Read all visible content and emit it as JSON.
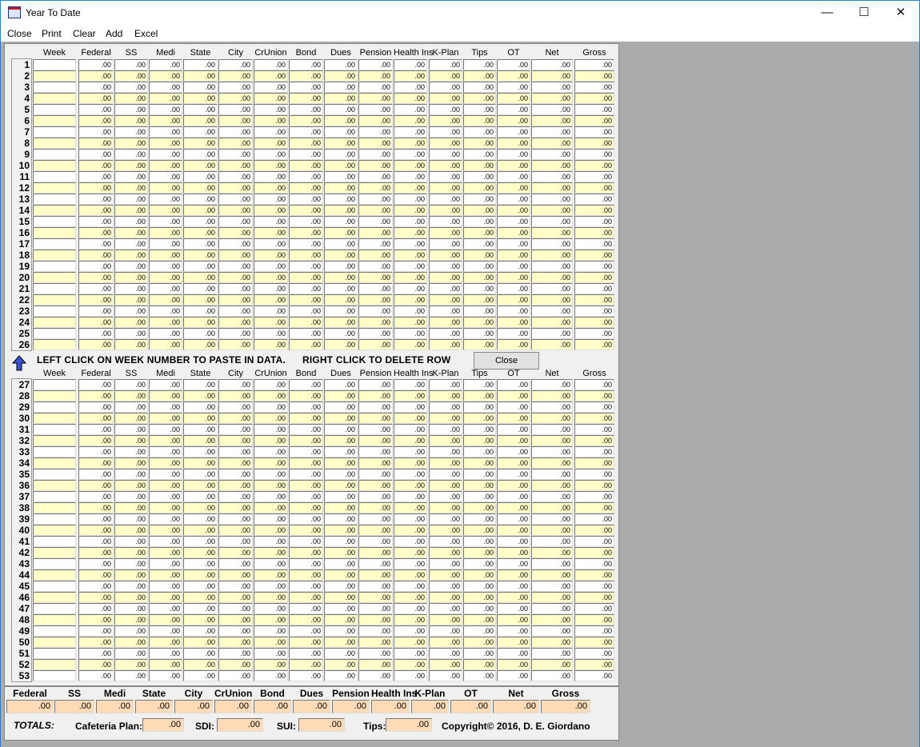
{
  "window": {
    "title": "Year To Date",
    "minimize": "—",
    "maximize": "☐",
    "close": "✕"
  },
  "menu": [
    "Close",
    "Print",
    "Clear",
    "Add",
    "Excel"
  ],
  "columns": [
    "Week",
    "Federal",
    "SS",
    "Medi",
    "State",
    "City",
    "CrUnion",
    "Bond",
    "Dues",
    "Pension",
    "Health Ins",
    "K-Plan",
    "Tips",
    "OT",
    "Net",
    "Gross"
  ],
  "rows": [
    {
      "n": "1",
      "week": "",
      "v": [
        ".00",
        ".00",
        ".00",
        ".00",
        ".00",
        ".00",
        ".00",
        ".00",
        ".00",
        ".00",
        ".00",
        ".00",
        ".00",
        ".00",
        ".00"
      ]
    },
    {
      "n": "2",
      "week": "",
      "v": [
        ".00",
        ".00",
        ".00",
        ".00",
        ".00",
        ".00",
        ".00",
        ".00",
        ".00",
        ".00",
        ".00",
        ".00",
        ".00",
        ".00",
        ".00"
      ]
    },
    {
      "n": "3",
      "week": "",
      "v": [
        ".00",
        ".00",
        ".00",
        ".00",
        ".00",
        ".00",
        ".00",
        ".00",
        ".00",
        ".00",
        ".00",
        ".00",
        ".00",
        ".00",
        ".00"
      ]
    },
    {
      "n": "4",
      "week": "",
      "v": [
        ".00",
        ".00",
        ".00",
        ".00",
        ".00",
        ".00",
        ".00",
        ".00",
        ".00",
        ".00",
        ".00",
        ".00",
        ".00",
        ".00",
        ".00"
      ]
    },
    {
      "n": "5",
      "week": "",
      "v": [
        ".00",
        ".00",
        ".00",
        ".00",
        ".00",
        ".00",
        ".00",
        ".00",
        ".00",
        ".00",
        ".00",
        ".00",
        ".00",
        ".00",
        ".00"
      ]
    },
    {
      "n": "6",
      "week": "",
      "v": [
        ".00",
        ".00",
        ".00",
        ".00",
        ".00",
        ".00",
        ".00",
        ".00",
        ".00",
        ".00",
        ".00",
        ".00",
        ".00",
        ".00",
        ".00"
      ]
    },
    {
      "n": "7",
      "week": "",
      "v": [
        ".00",
        ".00",
        ".00",
        ".00",
        ".00",
        ".00",
        ".00",
        ".00",
        ".00",
        ".00",
        ".00",
        ".00",
        ".00",
        ".00",
        ".00"
      ]
    },
    {
      "n": "8",
      "week": "",
      "v": [
        ".00",
        ".00",
        ".00",
        ".00",
        ".00",
        ".00",
        ".00",
        ".00",
        ".00",
        ".00",
        ".00",
        ".00",
        ".00",
        ".00",
        ".00"
      ]
    },
    {
      "n": "9",
      "week": "",
      "v": [
        ".00",
        ".00",
        ".00",
        ".00",
        ".00",
        ".00",
        ".00",
        ".00",
        ".00",
        ".00",
        ".00",
        ".00",
        ".00",
        ".00",
        ".00"
      ]
    },
    {
      "n": "10",
      "week": "",
      "v": [
        ".00",
        ".00",
        ".00",
        ".00",
        ".00",
        ".00",
        ".00",
        ".00",
        ".00",
        ".00",
        ".00",
        ".00",
        ".00",
        ".00",
        ".00"
      ]
    },
    {
      "n": "11",
      "week": "",
      "v": [
        ".00",
        ".00",
        ".00",
        ".00",
        ".00",
        ".00",
        ".00",
        ".00",
        ".00",
        ".00",
        ".00",
        ".00",
        ".00",
        ".00",
        ".00"
      ]
    },
    {
      "n": "12",
      "week": "",
      "v": [
        ".00",
        ".00",
        ".00",
        ".00",
        ".00",
        ".00",
        ".00",
        ".00",
        ".00",
        ".00",
        ".00",
        ".00",
        ".00",
        ".00",
        ".00"
      ]
    },
    {
      "n": "13",
      "week": "",
      "v": [
        ".00",
        ".00",
        ".00",
        ".00",
        ".00",
        ".00",
        ".00",
        ".00",
        ".00",
        ".00",
        ".00",
        ".00",
        ".00",
        ".00",
        ".00"
      ]
    },
    {
      "n": "14",
      "week": "",
      "v": [
        ".00",
        ".00",
        ".00",
        ".00",
        ".00",
        ".00",
        ".00",
        ".00",
        ".00",
        ".00",
        ".00",
        ".00",
        ".00",
        ".00",
        ".00"
      ]
    },
    {
      "n": "15",
      "week": "",
      "v": [
        ".00",
        ".00",
        ".00",
        ".00",
        ".00",
        ".00",
        ".00",
        ".00",
        ".00",
        ".00",
        ".00",
        ".00",
        ".00",
        ".00",
        ".00"
      ]
    },
    {
      "n": "16",
      "week": "",
      "v": [
        ".00",
        ".00",
        ".00",
        ".00",
        ".00",
        ".00",
        ".00",
        ".00",
        ".00",
        ".00",
        ".00",
        ".00",
        ".00",
        ".00",
        ".00"
      ]
    },
    {
      "n": "17",
      "week": "",
      "v": [
        ".00",
        ".00",
        ".00",
        ".00",
        ".00",
        ".00",
        ".00",
        ".00",
        ".00",
        ".00",
        ".00",
        ".00",
        ".00",
        ".00",
        ".00"
      ]
    },
    {
      "n": "18",
      "week": "",
      "v": [
        ".00",
        ".00",
        ".00",
        ".00",
        ".00",
        ".00",
        ".00",
        ".00",
        ".00",
        ".00",
        ".00",
        ".00",
        ".00",
        ".00",
        ".00"
      ]
    },
    {
      "n": "19",
      "week": "",
      "v": [
        ".00",
        ".00",
        ".00",
        ".00",
        ".00",
        ".00",
        ".00",
        ".00",
        ".00",
        ".00",
        ".00",
        ".00",
        ".00",
        ".00",
        ".00"
      ]
    },
    {
      "n": "20",
      "week": "",
      "v": [
        ".00",
        ".00",
        ".00",
        ".00",
        ".00",
        ".00",
        ".00",
        ".00",
        ".00",
        ".00",
        ".00",
        ".00",
        ".00",
        ".00",
        ".00"
      ]
    },
    {
      "n": "21",
      "week": "",
      "v": [
        ".00",
        ".00",
        ".00",
        ".00",
        ".00",
        ".00",
        ".00",
        ".00",
        ".00",
        ".00",
        ".00",
        ".00",
        ".00",
        ".00",
        ".00"
      ]
    },
    {
      "n": "22",
      "week": "",
      "v": [
        ".00",
        ".00",
        ".00",
        ".00",
        ".00",
        ".00",
        ".00",
        ".00",
        ".00",
        ".00",
        ".00",
        ".00",
        ".00",
        ".00",
        ".00"
      ]
    },
    {
      "n": "23",
      "week": "",
      "v": [
        ".00",
        ".00",
        ".00",
        ".00",
        ".00",
        ".00",
        ".00",
        ".00",
        ".00",
        ".00",
        ".00",
        ".00",
        ".00",
        ".00",
        ".00"
      ]
    },
    {
      "n": "24",
      "week": "",
      "v": [
        ".00",
        ".00",
        ".00",
        ".00",
        ".00",
        ".00",
        ".00",
        ".00",
        ".00",
        ".00",
        ".00",
        ".00",
        ".00",
        ".00",
        ".00"
      ]
    },
    {
      "n": "25",
      "week": "",
      "v": [
        ".00",
        ".00",
        ".00",
        ".00",
        ".00",
        ".00",
        ".00",
        ".00",
        ".00",
        ".00",
        ".00",
        ".00",
        ".00",
        ".00",
        ".00"
      ]
    },
    {
      "n": "26",
      "week": "",
      "v": [
        ".00",
        ".00",
        ".00",
        ".00",
        ".00",
        ".00",
        ".00",
        ".00",
        ".00",
        ".00",
        ".00",
        ".00",
        ".00",
        ".00",
        ".00"
      ]
    },
    {
      "n": "27",
      "week": "",
      "v": [
        ".00",
        ".00",
        ".00",
        ".00",
        ".00",
        ".00",
        ".00",
        ".00",
        ".00",
        ".00",
        ".00",
        ".00",
        ".00",
        ".00",
        ".00"
      ]
    },
    {
      "n": "28",
      "week": "",
      "v": [
        ".00",
        ".00",
        ".00",
        ".00",
        ".00",
        ".00",
        ".00",
        ".00",
        ".00",
        ".00",
        ".00",
        ".00",
        ".00",
        ".00",
        ".00"
      ]
    },
    {
      "n": "29",
      "week": "",
      "v": [
        ".00",
        ".00",
        ".00",
        ".00",
        ".00",
        ".00",
        ".00",
        ".00",
        ".00",
        ".00",
        ".00",
        ".00",
        ".00",
        ".00",
        ".00"
      ]
    },
    {
      "n": "30",
      "week": "",
      "v": [
        ".00",
        ".00",
        ".00",
        ".00",
        ".00",
        ".00",
        ".00",
        ".00",
        ".00",
        ".00",
        ".00",
        ".00",
        ".00",
        ".00",
        ".00"
      ]
    },
    {
      "n": "31",
      "week": "",
      "v": [
        ".00",
        ".00",
        ".00",
        ".00",
        ".00",
        ".00",
        ".00",
        ".00",
        ".00",
        ".00",
        ".00",
        ".00",
        ".00",
        ".00",
        ".00"
      ]
    },
    {
      "n": "32",
      "week": "",
      "v": [
        ".00",
        ".00",
        ".00",
        ".00",
        ".00",
        ".00",
        ".00",
        ".00",
        ".00",
        ".00",
        ".00",
        ".00",
        ".00",
        ".00",
        ".00"
      ]
    },
    {
      "n": "33",
      "week": "",
      "v": [
        ".00",
        ".00",
        ".00",
        ".00",
        ".00",
        ".00",
        ".00",
        ".00",
        ".00",
        ".00",
        ".00",
        ".00",
        ".00",
        ".00",
        ".00"
      ]
    },
    {
      "n": "34",
      "week": "",
      "v": [
        ".00",
        ".00",
        ".00",
        ".00",
        ".00",
        ".00",
        ".00",
        ".00",
        ".00",
        ".00",
        ".00",
        ".00",
        ".00",
        ".00",
        ".00"
      ]
    },
    {
      "n": "35",
      "week": "",
      "v": [
        ".00",
        ".00",
        ".00",
        ".00",
        ".00",
        ".00",
        ".00",
        ".00",
        ".00",
        ".00",
        ".00",
        ".00",
        ".00",
        ".00",
        ".00"
      ]
    },
    {
      "n": "36",
      "week": "",
      "v": [
        ".00",
        ".00",
        ".00",
        ".00",
        ".00",
        ".00",
        ".00",
        ".00",
        ".00",
        ".00",
        ".00",
        ".00",
        ".00",
        ".00",
        ".00"
      ]
    },
    {
      "n": "37",
      "week": "",
      "v": [
        ".00",
        ".00",
        ".00",
        ".00",
        ".00",
        ".00",
        ".00",
        ".00",
        ".00",
        ".00",
        ".00",
        ".00",
        ".00",
        ".00",
        ".00"
      ]
    },
    {
      "n": "38",
      "week": "",
      "v": [
        ".00",
        ".00",
        ".00",
        ".00",
        ".00",
        ".00",
        ".00",
        ".00",
        ".00",
        ".00",
        ".00",
        ".00",
        ".00",
        ".00",
        ".00"
      ]
    },
    {
      "n": "39",
      "week": "",
      "v": [
        ".00",
        ".00",
        ".00",
        ".00",
        ".00",
        ".00",
        ".00",
        ".00",
        ".00",
        ".00",
        ".00",
        ".00",
        ".00",
        ".00",
        ".00"
      ]
    },
    {
      "n": "40",
      "week": "",
      "v": [
        ".00",
        ".00",
        ".00",
        ".00",
        ".00",
        ".00",
        ".00",
        ".00",
        ".00",
        ".00",
        ".00",
        ".00",
        ".00",
        ".00",
        ".00"
      ]
    },
    {
      "n": "41",
      "week": "",
      "v": [
        ".00",
        ".00",
        ".00",
        ".00",
        ".00",
        ".00",
        ".00",
        ".00",
        ".00",
        ".00",
        ".00",
        ".00",
        ".00",
        ".00",
        ".00"
      ]
    },
    {
      "n": "42",
      "week": "",
      "v": [
        ".00",
        ".00",
        ".00",
        ".00",
        ".00",
        ".00",
        ".00",
        ".00",
        ".00",
        ".00",
        ".00",
        ".00",
        ".00",
        ".00",
        ".00"
      ]
    },
    {
      "n": "43",
      "week": "",
      "v": [
        ".00",
        ".00",
        ".00",
        ".00",
        ".00",
        ".00",
        ".00",
        ".00",
        ".00",
        ".00",
        ".00",
        ".00",
        ".00",
        ".00",
        ".00"
      ]
    },
    {
      "n": "44",
      "week": "",
      "v": [
        ".00",
        ".00",
        ".00",
        ".00",
        ".00",
        ".00",
        ".00",
        ".00",
        ".00",
        ".00",
        ".00",
        ".00",
        ".00",
        ".00",
        ".00"
      ]
    },
    {
      "n": "45",
      "week": "",
      "v": [
        ".00",
        ".00",
        ".00",
        ".00",
        ".00",
        ".00",
        ".00",
        ".00",
        ".00",
        ".00",
        ".00",
        ".00",
        ".00",
        ".00",
        ".00"
      ]
    },
    {
      "n": "46",
      "week": "",
      "v": [
        ".00",
        ".00",
        ".00",
        ".00",
        ".00",
        ".00",
        ".00",
        ".00",
        ".00",
        ".00",
        ".00",
        ".00",
        ".00",
        ".00",
        ".00"
      ]
    },
    {
      "n": "47",
      "week": "",
      "v": [
        ".00",
        ".00",
        ".00",
        ".00",
        ".00",
        ".00",
        ".00",
        ".00",
        ".00",
        ".00",
        ".00",
        ".00",
        ".00",
        ".00",
        ".00"
      ]
    },
    {
      "n": "48",
      "week": "",
      "v": [
        ".00",
        ".00",
        ".00",
        ".00",
        ".00",
        ".00",
        ".00",
        ".00",
        ".00",
        ".00",
        ".00",
        ".00",
        ".00",
        ".00",
        ".00"
      ]
    },
    {
      "n": "49",
      "week": "",
      "v": [
        ".00",
        ".00",
        ".00",
        ".00",
        ".00",
        ".00",
        ".00",
        ".00",
        ".00",
        ".00",
        ".00",
        ".00",
        ".00",
        ".00",
        ".00"
      ]
    },
    {
      "n": "50",
      "week": "",
      "v": [
        ".00",
        ".00",
        ".00",
        ".00",
        ".00",
        ".00",
        ".00",
        ".00",
        ".00",
        ".00",
        ".00",
        ".00",
        ".00",
        ".00",
        ".00"
      ]
    },
    {
      "n": "51",
      "week": "",
      "v": [
        ".00",
        ".00",
        ".00",
        ".00",
        ".00",
        ".00",
        ".00",
        ".00",
        ".00",
        ".00",
        ".00",
        ".00",
        ".00",
        ".00",
        ".00"
      ]
    },
    {
      "n": "52",
      "week": "",
      "v": [
        ".00",
        ".00",
        ".00",
        ".00",
        ".00",
        ".00",
        ".00",
        ".00",
        ".00",
        ".00",
        ".00",
        ".00",
        ".00",
        ".00",
        ".00"
      ]
    },
    {
      "n": "53",
      "week": "",
      "v": [
        ".00",
        ".00",
        ".00",
        ".00",
        ".00",
        ".00",
        ".00",
        ".00",
        ".00",
        ".00",
        ".00",
        ".00",
        ".00",
        ".00",
        ".00"
      ]
    }
  ],
  "instructions": {
    "left": "LEFT CLICK ON WEEK NUMBER TO PASTE IN DATA.",
    "right": "RIGHT CLICK TO DELETE ROW",
    "close": "Close"
  },
  "totals": {
    "labels": [
      "Federal",
      "SS",
      "Medi",
      "State",
      "City",
      "CrUnion",
      "Bond",
      "Dues",
      "Pension",
      "Health Ins",
      "K-Plan",
      "OT",
      "Net",
      "Gross"
    ],
    "values": [
      ".00",
      ".00",
      ".00",
      ".00",
      ".00",
      ".00",
      ".00",
      ".00",
      ".00",
      ".00",
      ".00",
      ".00",
      ".00",
      ".00"
    ],
    "title": "TOTALS:",
    "extra": [
      {
        "label": "Cafeteria Plan:",
        "value": ".00"
      },
      {
        "label": "SDI:",
        "value": ".00"
      },
      {
        "label": "SUI:",
        "value": ".00"
      },
      {
        "label": "Tips:",
        "value": ".00"
      }
    ],
    "copyright": "Copyright© 2016, D. E. Giordano"
  },
  "colors": {
    "odd_row": "#ffffff",
    "even_row": "#ffffc8",
    "totals_field": "#ffdbb8"
  }
}
